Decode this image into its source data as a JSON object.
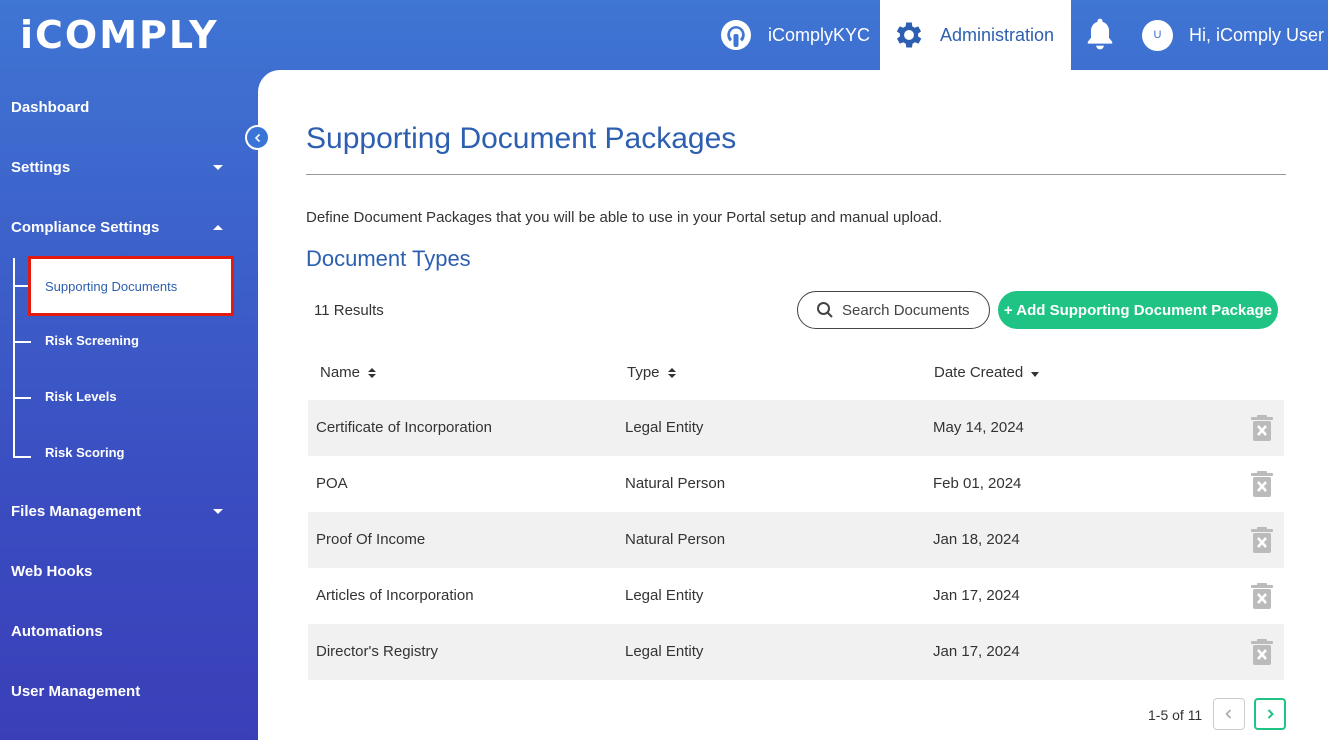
{
  "app": {
    "logo": "iCOMPLY"
  },
  "topnav": {
    "kyc_label": "iComplyKYC",
    "admin_label": "Administration",
    "user_initial": "U",
    "user_greeting": "Hi, iComply User"
  },
  "sidebar": {
    "items": [
      {
        "label": "Dashboard"
      },
      {
        "label": "Settings"
      },
      {
        "label": "Compliance Settings"
      },
      {
        "label": "Files Management"
      },
      {
        "label": "Web Hooks"
      },
      {
        "label": "Automations"
      },
      {
        "label": "User Management"
      }
    ],
    "sub_items": [
      {
        "label": "Supporting Documents",
        "active": true
      },
      {
        "label": "Risk Screening"
      },
      {
        "label": "Risk Levels"
      },
      {
        "label": "Risk Scoring"
      }
    ]
  },
  "main": {
    "title": "Supporting Document Packages",
    "description": "Define Document Packages that you will be able to use in your Portal setup and manual upload.",
    "section_title": "Document Types",
    "results": "11 Results",
    "search_label": "Search Documents",
    "add_label": "+ Add Supporting Document Package"
  },
  "table": {
    "headers": {
      "name": "Name",
      "type": "Type",
      "date": "Date Created"
    },
    "rows": [
      {
        "name": "Certificate of Incorporation",
        "type": "Legal Entity",
        "date": "May 14, 2024"
      },
      {
        "name": "POA",
        "type": "Natural Person",
        "date": "Feb 01, 2024"
      },
      {
        "name": "Proof Of Income",
        "type": "Natural Person",
        "date": "Jan 18, 2024"
      },
      {
        "name": "Articles of Incorporation",
        "type": "Legal Entity",
        "date": "Jan 17, 2024"
      },
      {
        "name": "Director's Registry",
        "type": "Legal Entity",
        "date": "Jan 17, 2024"
      }
    ]
  },
  "pagination": {
    "text": "1-5 of 11"
  },
  "colors": {
    "brand_blue": "#2d5fb0",
    "accent_green": "#1fc383",
    "highlight_red": "#e31b0f"
  },
  "icons": [
    "kyc-icon",
    "gear-icon",
    "bell-icon",
    "trash-icon",
    "search-icon",
    "chevron-left-icon",
    "chevron-right-icon"
  ]
}
